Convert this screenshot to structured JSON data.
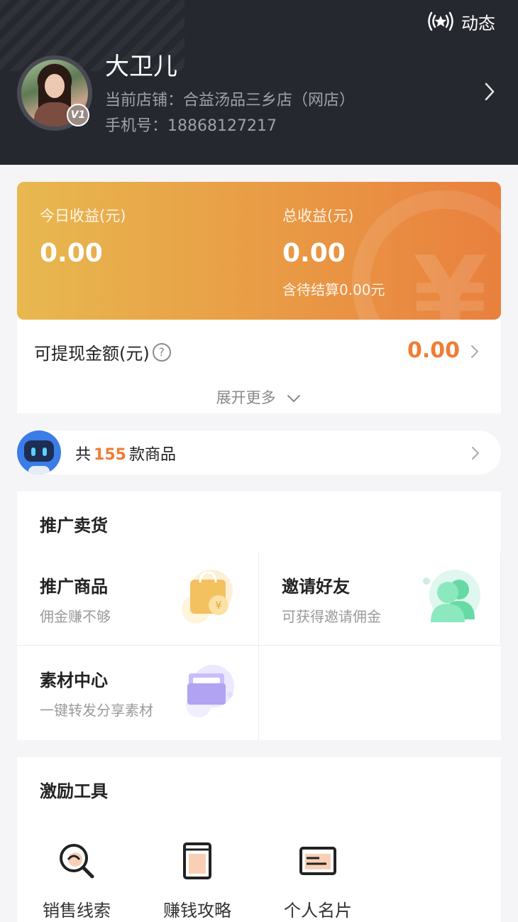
{
  "header": {
    "dynamic_label": "动态",
    "user_name": "大卫儿",
    "shop": "当前店铺：合益汤品三乡店（网店）",
    "phone": "手机号：18868127217",
    "vip_badge": "V1"
  },
  "earnings": {
    "today_label": "今日收益(元)",
    "today_value": "0.00",
    "total_label": "总收益(元)",
    "total_value": "0.00",
    "pending": "含待结算0.00元",
    "watermark": "¥"
  },
  "withdraw": {
    "label": "可提现金额(元)",
    "help": "?",
    "value": "0.00",
    "expand": "展开更多"
  },
  "goods": {
    "prefix": "共",
    "count": "155",
    "suffix": "款商品"
  },
  "promote": {
    "title": "推广卖货",
    "items": [
      {
        "title": "推广商品",
        "subtitle": "佣金赚不够",
        "icon": "shopping-bag-icon"
      },
      {
        "title": "邀请好友",
        "subtitle": "可获得邀请佣金",
        "icon": "friends-icon"
      },
      {
        "title": "素材中心",
        "subtitle": "一键转发分享素材",
        "icon": "folder-icon"
      }
    ]
  },
  "tools": {
    "title": "激励工具",
    "items": [
      {
        "label": "销售线索",
        "icon": "search-lead-icon"
      },
      {
        "label": "赚钱攻略",
        "icon": "book-icon"
      },
      {
        "label": "个人名片",
        "icon": "card-icon"
      }
    ]
  },
  "colors": {
    "header_bg": "#262830",
    "accent_orange": "#ef7d34",
    "card_gradient_start": "#e8b84f",
    "card_gradient_end": "#e9803e"
  }
}
